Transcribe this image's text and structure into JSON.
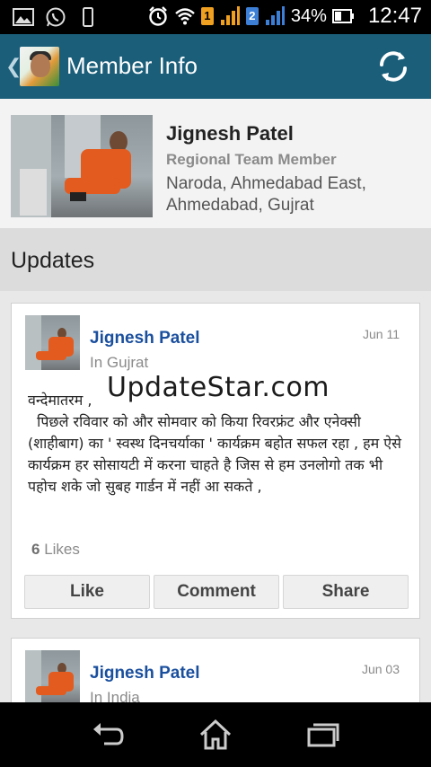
{
  "status_bar": {
    "sim1": "1",
    "sim2": "2",
    "battery": "34%",
    "time": "12:47",
    "icons": [
      "gallery-icon",
      "whatsapp-icon",
      "phone-device-icon",
      "alarm-clock-icon",
      "wifi-icon",
      "signal-icon",
      "battery-icon"
    ]
  },
  "action_bar": {
    "title": "Member Info",
    "color": "#1a5e7a",
    "icons": [
      "back-chevron-icon",
      "refresh-icon"
    ]
  },
  "profile": {
    "name": "Jignesh Patel",
    "role": "Regional Team Member",
    "location": "Naroda, Ahmedabad East, Ahmedabad, Gujrat"
  },
  "updates": {
    "header": "Updates",
    "posts": [
      {
        "author": "Jignesh Patel",
        "location": "In Gujrat",
        "date": "Jun 11",
        "body": "वन्देमातरम ,\n  पिछले रविवार को और सोमवार को किया रिवरफ्रंट और एनेक्सी (शाहीबाग) का ' स्वस्थ दिनचर्याका ' कार्यक्रम बहोत सफल रहा , हम ऐसे कार्यक्रम हर सोसायटी में करना चाहते है जिस से हम उनलोगो तक भी पहोच शके जो सुबह गार्डन में नहीं आ सकते ,",
        "likes_count": "6",
        "likes_label": "Likes",
        "actions": [
          "Like",
          "Comment",
          "Share"
        ]
      },
      {
        "author": "Jignesh Patel",
        "location": "In India",
        "date": "Jun 03"
      }
    ]
  },
  "watermark": "UpdateStar.com",
  "nav_bar": {
    "icons": [
      "back-icon",
      "home-icon",
      "recent-apps-icon"
    ]
  }
}
